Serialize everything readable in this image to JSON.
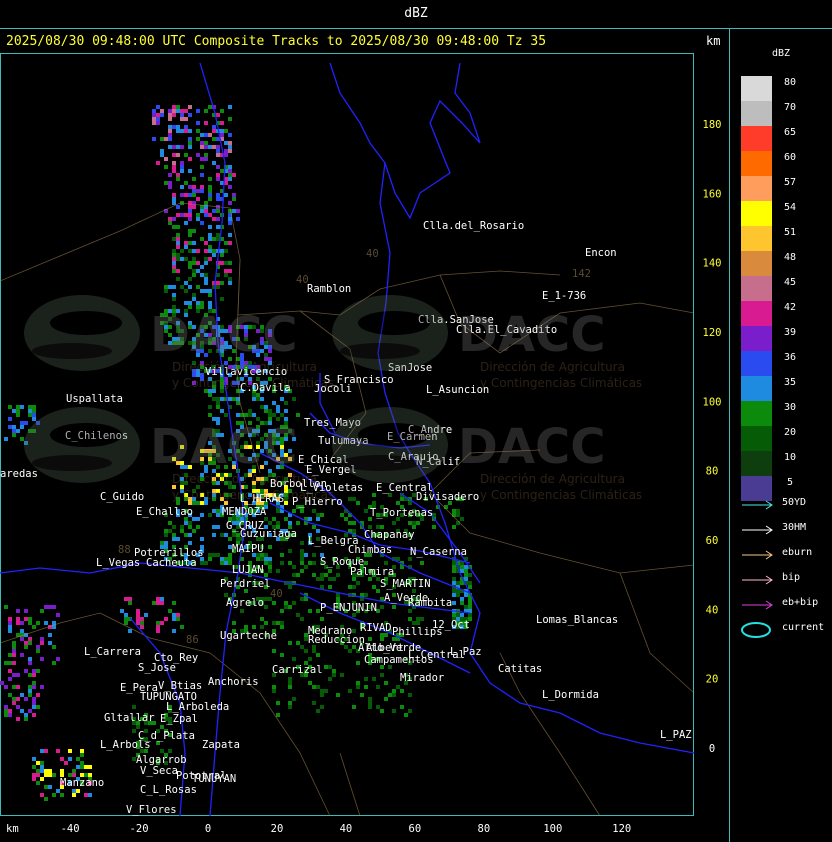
{
  "header": {
    "title": "dBZ"
  },
  "subheader": {
    "caption": "2025/08/30 09:48:00 UTC Composite Tracks to 2025/08/30 09:48:00 Tz 35",
    "unit": "km"
  },
  "axes": {
    "x_unit": "km",
    "x_ticks": [
      "-40",
      "-20",
      "0",
      "20",
      "40",
      "60",
      "80",
      "100",
      "120"
    ],
    "y_ticks": [
      "180",
      "160",
      "140",
      "120",
      "100",
      "80",
      "60",
      "40",
      "20",
      "0"
    ]
  },
  "legend": {
    "title": "dBZ",
    "scale": [
      {
        "label": "80",
        "color": "#d9d9d9"
      },
      {
        "label": "70",
        "color": "#bdbdbd"
      },
      {
        "label": "65",
        "color": "#ff3b2a"
      },
      {
        "label": "60",
        "color": "#ff6a00"
      },
      {
        "label": "57",
        "color": "#ff9d5c"
      },
      {
        "label": "54",
        "color": "#ffff00"
      },
      {
        "label": "51",
        "color": "#ffc52e"
      },
      {
        "label": "48",
        "color": "#d98a3c"
      },
      {
        "label": "45",
        "color": "#c76e8c"
      },
      {
        "label": "42",
        "color": "#d81b90"
      },
      {
        "label": "39",
        "color": "#7a1ecc"
      },
      {
        "label": "36",
        "color": "#2a4bf0"
      },
      {
        "label": "35",
        "color": "#1e8ae0"
      },
      {
        "label": "30",
        "color": "#0c8a0c"
      },
      {
        "label": "20",
        "color": "#065c06"
      },
      {
        "label": "10",
        "color": "#0e3e0e"
      },
      {
        "label": "5",
        "color": "#4b3c93"
      }
    ],
    "tracks": [
      {
        "label": "50YD",
        "color": "#4fe6e6",
        "type": "arrow"
      },
      {
        "label": "30HM",
        "color": "#ffffff",
        "type": "arrow"
      },
      {
        "label": "eburn",
        "color": "#f2c98a",
        "type": "arrow"
      },
      {
        "label": "bip",
        "color": "#ffb6d9",
        "type": "arrow"
      },
      {
        "label": "eb+bip",
        "color": "#e040e0",
        "type": "arrow"
      },
      {
        "label": "current",
        "color": "#22e0e0",
        "type": "ellipse"
      }
    ]
  },
  "watermark": {
    "brand": "DACC",
    "line1": "Dirección de Agricultura",
    "line2": "y Contingencias Climáticas"
  },
  "places": [
    {
      "name": "Clla.del_Rosario"
    },
    {
      "name": "Encon"
    },
    {
      "name": "E_1-736"
    },
    {
      "name": "Ramblon"
    },
    {
      "name": "Clla.SanJose"
    },
    {
      "name": "Clla.El_Cavadito"
    },
    {
      "name": "Villavicencio"
    },
    {
      "name": "C.Davila"
    },
    {
      "name": "S_Francisco"
    },
    {
      "name": "SanJose"
    },
    {
      "name": "Jocoli"
    },
    {
      "name": "L_Asuncion"
    },
    {
      "name": "Uspallata"
    },
    {
      "name": "Tres_Mayo"
    },
    {
      "name": "C_Andre"
    },
    {
      "name": "C_Chilenos"
    },
    {
      "name": "E_Carmen"
    },
    {
      "name": "Tulumaya"
    },
    {
      "name": "C_Araujo"
    },
    {
      "name": "E_Chical"
    },
    {
      "name": "N_Calif"
    },
    {
      "name": "E_Vergel"
    },
    {
      "name": "aredas"
    },
    {
      "name": "Borbollon"
    },
    {
      "name": "L_Violetas"
    },
    {
      "name": "E_Central"
    },
    {
      "name": "Divisadero"
    },
    {
      "name": "C_Guido"
    },
    {
      "name": "L_HERAS"
    },
    {
      "name": "P_Hierro"
    },
    {
      "name": "E_Challao"
    },
    {
      "name": "MENDOZA"
    },
    {
      "name": "T_Portenas"
    },
    {
      "name": "G_CRUZ"
    },
    {
      "name": "Guzuriaga"
    },
    {
      "name": "Chapanay"
    },
    {
      "name": "MAIPU"
    },
    {
      "name": "L_Belgra"
    },
    {
      "name": "Chimbas"
    },
    {
      "name": "N_Caserna"
    },
    {
      "name": "Potrerillos"
    },
    {
      "name": "Cacheuta"
    },
    {
      "name": "L_Vegas"
    },
    {
      "name": "LUJAN"
    },
    {
      "name": "S_Roque"
    },
    {
      "name": "Palmira"
    },
    {
      "name": "Perdriel"
    },
    {
      "name": "S_MARTIN"
    },
    {
      "name": "A_Verde"
    },
    {
      "name": "Rambita"
    },
    {
      "name": "Agrelo"
    },
    {
      "name": "P_ENJUNIN"
    },
    {
      "name": "Lomas_Blancas"
    },
    {
      "name": "Ugarteche"
    },
    {
      "name": "RIVAD"
    },
    {
      "name": "Phillips"
    },
    {
      "name": "12_Oct"
    },
    {
      "name": "Medrano"
    },
    {
      "name": "Reduccion"
    },
    {
      "name": "Alto_Verde"
    },
    {
      "name": "L_Carrera"
    },
    {
      "name": "Cto_Rey"
    },
    {
      "name": "Albert"
    },
    {
      "name": "L_Paz"
    },
    {
      "name": "S_Jose"
    },
    {
      "name": "Carrizal"
    },
    {
      "name": "Campamentos"
    },
    {
      "name": "L_Central"
    },
    {
      "name": "Catitas"
    },
    {
      "name": "Anchoris"
    },
    {
      "name": "Mirador"
    },
    {
      "name": "E_Pera"
    },
    {
      "name": "V_Btias"
    },
    {
      "name": "TUPUNGATO"
    },
    {
      "name": "L_Dormida"
    },
    {
      "name": "L_Arboleda"
    },
    {
      "name": "Gltallar"
    },
    {
      "name": "E_Zpal"
    },
    {
      "name": "L_PAZ"
    },
    {
      "name": "C_d_Plata"
    },
    {
      "name": "L_Arbols"
    },
    {
      "name": "Zapata"
    },
    {
      "name": "Algarrob"
    },
    {
      "name": "V_Seca"
    },
    {
      "name": "Pototral"
    },
    {
      "name": "TUNUYAN"
    },
    {
      "name": "Manzano"
    },
    {
      "name": "C_L_Rosas"
    },
    {
      "name": "V_Flores"
    }
  ],
  "route_numbers": [
    "40",
    "142",
    "40",
    "88",
    "86",
    "40"
  ]
}
